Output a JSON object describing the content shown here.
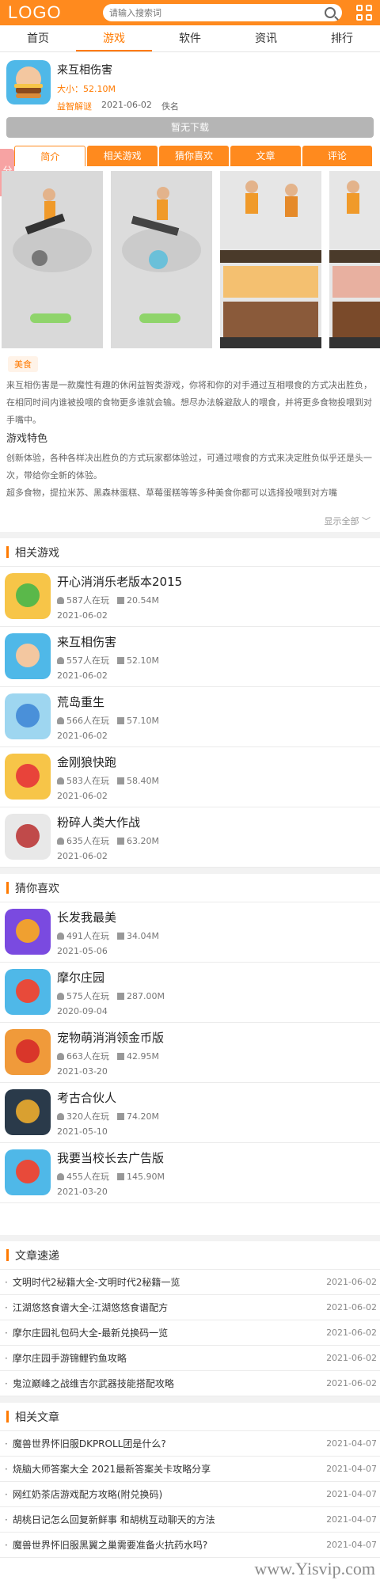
{
  "header": {
    "logo": "LOGO",
    "search_placeholder": "请输入搜索词"
  },
  "nav": [
    "首页",
    "游戏",
    "软件",
    "资讯",
    "排行"
  ],
  "app": {
    "name": "来互相伤害",
    "size": "大小：52.10M",
    "tag": "益智解谜",
    "date": "2021-06-02",
    "author": "佚名",
    "download": "暂无下载"
  },
  "share": "分享",
  "tabs": [
    "简介",
    "相关游戏",
    "猜你喜欢",
    "文章",
    "评论"
  ],
  "food_tag": "美食",
  "desc": {
    "p1": "来互相伤害是一款魔性有趣的休闲益智类游戏，你将和你的对手通过互相喂食的方式决出胜负，在相同时间内谁被投喂的食物更多谁就会输。想尽办法躲避敌人的喂食，并将更多食物投喂到对手嘴中。",
    "h": "游戏特色",
    "p2": "创新体验，各种各样决出胜负的方式玩家都体验过，可通过喂食的方式来决定胜负似乎还是头一次，带给你全新的体验。",
    "p3": "超多食物，提拉米苏、黑森林蛋糕、草莓蛋糕等等多种美食你都可以选择投喂到对方嘴"
  },
  "show_all": "显示全部",
  "related": {
    "title": "相关游戏",
    "items": [
      {
        "name": "开心消消乐老版本2015",
        "players": "587人在玩",
        "size": "20.54M",
        "date": "2021-06-02"
      },
      {
        "name": "来互相伤害",
        "players": "557人在玩",
        "size": "52.10M",
        "date": "2021-06-02"
      },
      {
        "name": "荒岛重生",
        "players": "566人在玩",
        "size": "57.10M",
        "date": "2021-06-02"
      },
      {
        "name": "金刚狼快跑",
        "players": "583人在玩",
        "size": "58.40M",
        "date": "2021-06-02"
      },
      {
        "name": "粉碎人类大作战",
        "players": "635人在玩",
        "size": "63.20M",
        "date": "2021-06-02"
      }
    ]
  },
  "guess": {
    "title": "猜你喜欢",
    "items": [
      {
        "name": "长发我最美",
        "players": "491人在玩",
        "size": "34.04M",
        "date": "2021-05-06"
      },
      {
        "name": "摩尔庄园",
        "players": "575人在玩",
        "size": "287.00M",
        "date": "2020-09-04"
      },
      {
        "name": "宠物萌消消领金币版",
        "players": "663人在玩",
        "size": "42.95M",
        "date": "2021-03-20"
      },
      {
        "name": "考古合伙人",
        "players": "320人在玩",
        "size": "74.20M",
        "date": "2021-05-10"
      },
      {
        "name": "我要当校长去广告版",
        "players": "455人在玩",
        "size": "145.90M",
        "date": "2021-03-20"
      }
    ]
  },
  "quick": {
    "title": "文章速递",
    "items": [
      {
        "t": "文明时代2秘籍大全-文明时代2秘籍一览",
        "d": "2021-06-02"
      },
      {
        "t": "江湖悠悠食谱大全-江湖悠悠食谱配方",
        "d": "2021-06-02"
      },
      {
        "t": "摩尔庄园礼包码大全-最新兑换码一览",
        "d": "2021-06-02"
      },
      {
        "t": "摩尔庄园手游锦鲤钓鱼攻略",
        "d": "2021-06-02"
      },
      {
        "t": "鬼泣巅峰之战维吉尔武器技能搭配攻略",
        "d": "2021-06-02"
      }
    ]
  },
  "articles": {
    "title": "相关文章",
    "items": [
      {
        "t": "魔兽世界怀旧服DKPROLL团是什么?",
        "d": "2021-04-07"
      },
      {
        "t": "烧脑大师答案大全 2021最新答案关卡攻略分享",
        "d": "2021-04-07"
      },
      {
        "t": "网红奶茶店游戏配方攻略(附兑换码)",
        "d": "2021-04-07"
      },
      {
        "t": "胡桃日记怎么回复新鲜事 和胡桃互动聊天的方法",
        "d": "2021-04-07"
      },
      {
        "t": "魔兽世界怀旧服黑翼之巢需要准备火抗药水吗?",
        "d": "2021-04-07"
      }
    ]
  },
  "watermark": "www.Yisvip.com",
  "colors": {
    "accent": "#ff7a00",
    "header": "#ff8a1e"
  }
}
